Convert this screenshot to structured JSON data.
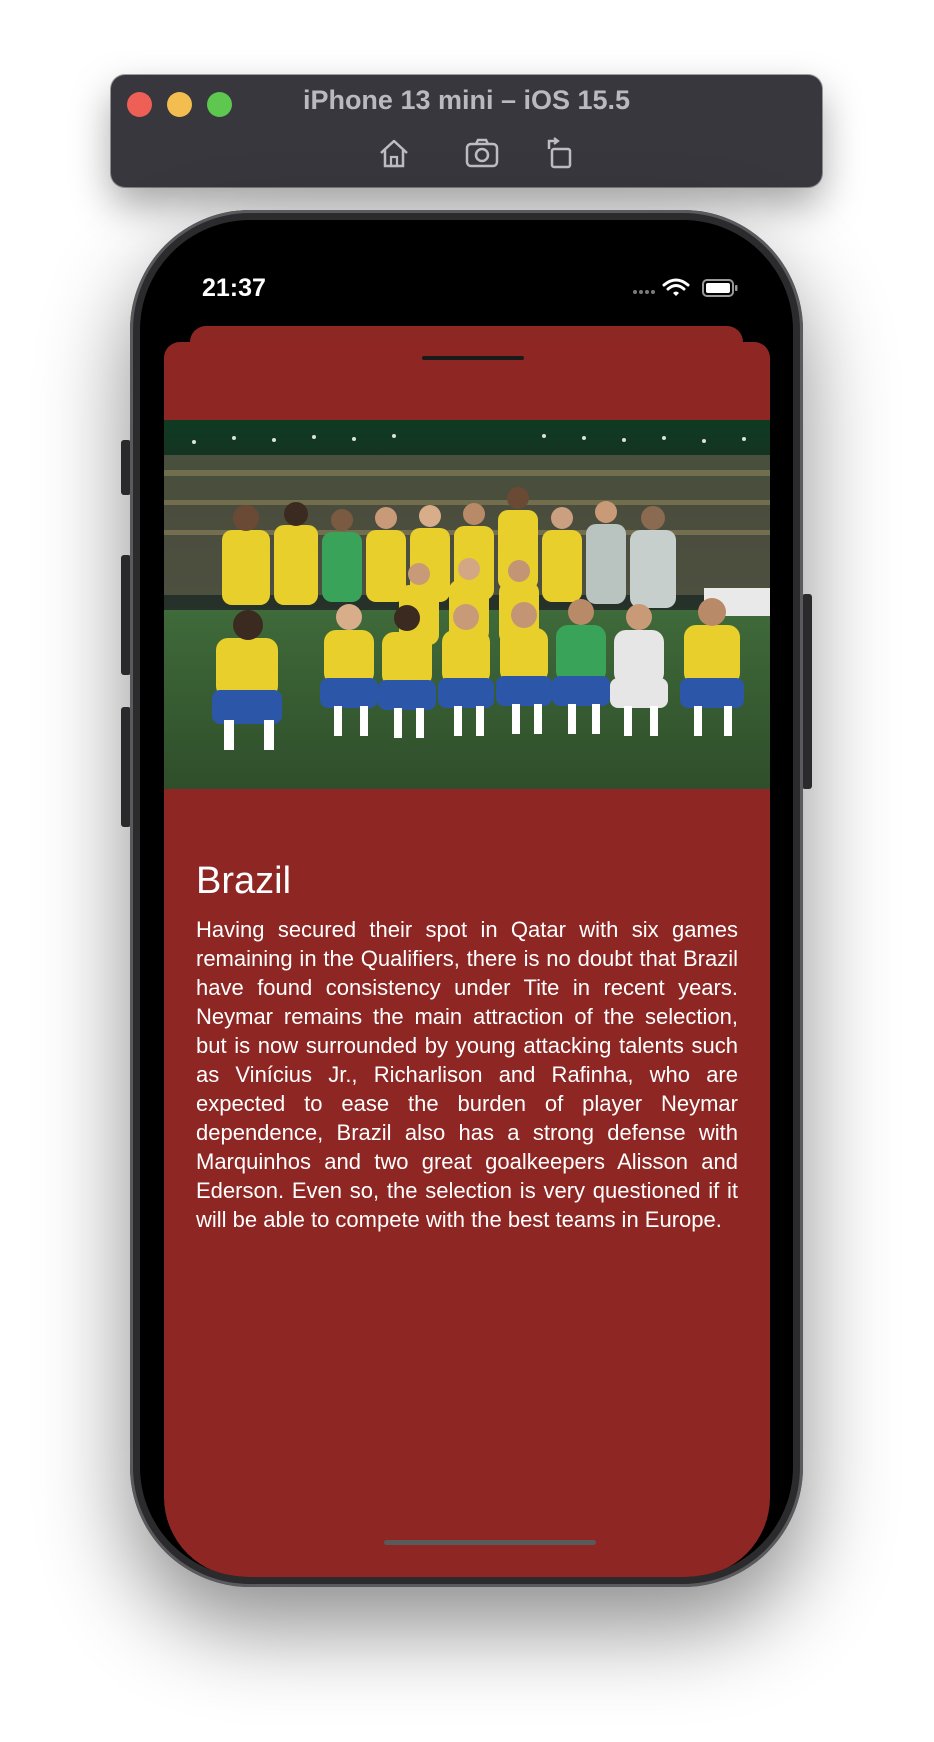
{
  "simulator": {
    "title": "iPhone 13 mini – iOS 15.5",
    "icons": [
      "home-icon",
      "screenshot-icon",
      "rotate-icon"
    ]
  },
  "status_bar": {
    "time": "21:37",
    "icons": [
      "signal-icon",
      "wifi-icon",
      "battery-icon"
    ]
  },
  "sheet": {
    "photo_description": "Brazil national team celebrating on the pitch",
    "team_name": "Brazil",
    "description": "Having secured their spot in Qatar with six games remaining in the Qualifiers, there is no doubt that Brazil have found consistency under Tite in recent years. Neymar remains the main attraction of the selection, but is now surrounded by young attacking talents such as Vinícius Jr., Richarlison and Rafinha, who are expected to ease the burden of player Neymar dependence, Brazil also has a strong defense with Marquinhos and two great goalkeepers Alisson and Ederson. Even so, the selection is very questioned if it will be able to compete with the best teams in Europe."
  },
  "colors": {
    "sheet_background": "#8e2724",
    "jersey_yellow": "#e8cf2b",
    "shorts_blue": "#2c56a8"
  }
}
